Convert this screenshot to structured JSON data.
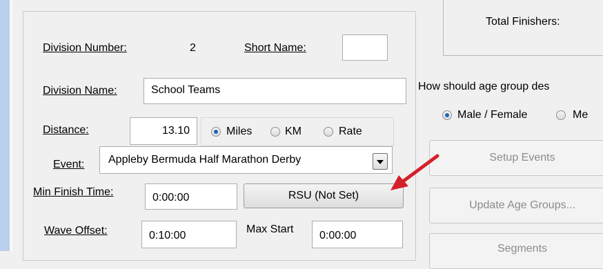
{
  "division_number": {
    "label": "Division Number:",
    "value": "2"
  },
  "short_name": {
    "label": "Short Name:",
    "value": ""
  },
  "division_name": {
    "label": "Division Name:",
    "value": "School Teams"
  },
  "distance": {
    "label": "Distance:",
    "value": "13.10",
    "units": [
      "Miles",
      "KM",
      "Rate"
    ],
    "selected": "Miles"
  },
  "event": {
    "label": "Event:",
    "value": "Appleby Bermuda Half Marathon Derby"
  },
  "min_finish_time": {
    "label": "Min Finish Time:",
    "value": "0:00:00"
  },
  "rsu_button": {
    "label": "RSU (Not Set)"
  },
  "wave_offset": {
    "label": "Wave Offset:",
    "value": "0:10:00"
  },
  "max_start": {
    "label": "Max Start",
    "value": "0:00:00"
  },
  "total_finishers": {
    "label": "Total Finishers:"
  },
  "age_group": {
    "question": "How should age group des",
    "options": [
      "Male / Female",
      "Me"
    ],
    "selected": "Male / Female"
  },
  "buttons": {
    "setup_events": "Setup Events",
    "update_age_groups": "Update Age Groups...",
    "segments": "Segments"
  },
  "colors": {
    "annotation_arrow": "#d4202a",
    "radio_selected": "#1f64b6"
  }
}
